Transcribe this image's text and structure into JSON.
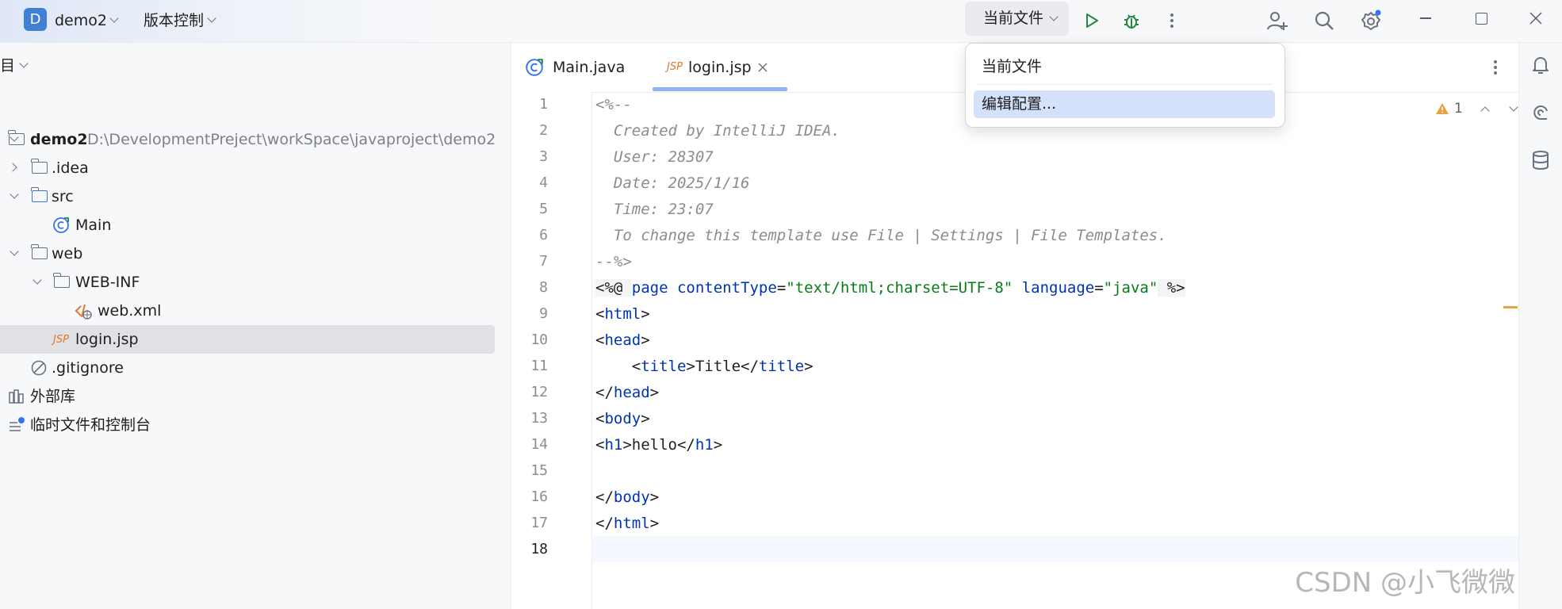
{
  "titlebar": {
    "project_letter": "D",
    "project_name": "demo2",
    "vcs_label": "版本控制",
    "run_config": "当前文件"
  },
  "project_panel": {
    "header": "目",
    "root_name": "demo2",
    "root_path": "D:\\DevelopmentPreject\\workSpace\\javaproject\\demo2",
    "items": [
      {
        "label": ".idea"
      },
      {
        "label": "src"
      },
      {
        "label": "Main"
      },
      {
        "label": "web"
      },
      {
        "label": "WEB-INF"
      },
      {
        "label": "web.xml"
      },
      {
        "label": "login.jsp"
      },
      {
        "label": ".gitignore"
      },
      {
        "label": "外部库"
      },
      {
        "label": "临时文件和控制台"
      }
    ]
  },
  "editor": {
    "tabs": [
      {
        "label": "Main.java"
      },
      {
        "label": "login.jsp"
      }
    ],
    "jsp_badge": "JSP",
    "warning_count": "1",
    "line_numbers": [
      "1",
      "2",
      "3",
      "4",
      "5",
      "6",
      "7",
      "8",
      "9",
      "10",
      "11",
      "12",
      "13",
      "14",
      "15",
      "16",
      "17",
      "18"
    ],
    "lines": {
      "l1": "<%--",
      "l2": "  Created by IntelliJ IDEA.",
      "l3": "  User: 28307",
      "l4": "  Date: 2025/1/16",
      "l5": "  Time: 23:07",
      "l6": "  To change this template use File | Settings | File Templates.",
      "l7": "--%>",
      "l8": {
        "open": "<%@ ",
        "page": "page",
        "ct_attr": " contentType",
        "eq1": "=",
        "ct_val": "\"text/html;charset=UTF-8\"",
        "lang_attr": " language",
        "eq2": "=",
        "lang_val": "\"java\"",
        "close": " %>"
      },
      "l9": {
        "lt": "<",
        "name": "html",
        "gt": ">"
      },
      "l10": {
        "lt": "<",
        "name": "head",
        "gt": ">"
      },
      "l11": {
        "indent": "    <",
        "name": "title",
        "mid": ">Title</",
        "name2": "title",
        "gt": ">"
      },
      "l12": {
        "lt": "</",
        "name": "head",
        "gt": ">"
      },
      "l13": {
        "lt": "<",
        "name": "body",
        "gt": ">"
      },
      "l14": {
        "lt": "<",
        "name": "h1",
        "mid": ">hello</",
        "name2": "h1",
        "gt": ">"
      },
      "l16": {
        "lt": "</",
        "name": "body",
        "gt": ">"
      },
      "l17": {
        "lt": "</",
        "name": "html",
        "gt": ">"
      }
    }
  },
  "popup": {
    "items": [
      {
        "label": "当前文件"
      },
      {
        "label": "编辑配置..."
      }
    ]
  },
  "watermark": "CSDN @小飞微微",
  "colors": {
    "accent": "#3574f0",
    "run_green": "#208a3c",
    "debug_green": "#208a3c",
    "jsp_orange": "#e0782d",
    "warning": "#e8a33d"
  }
}
